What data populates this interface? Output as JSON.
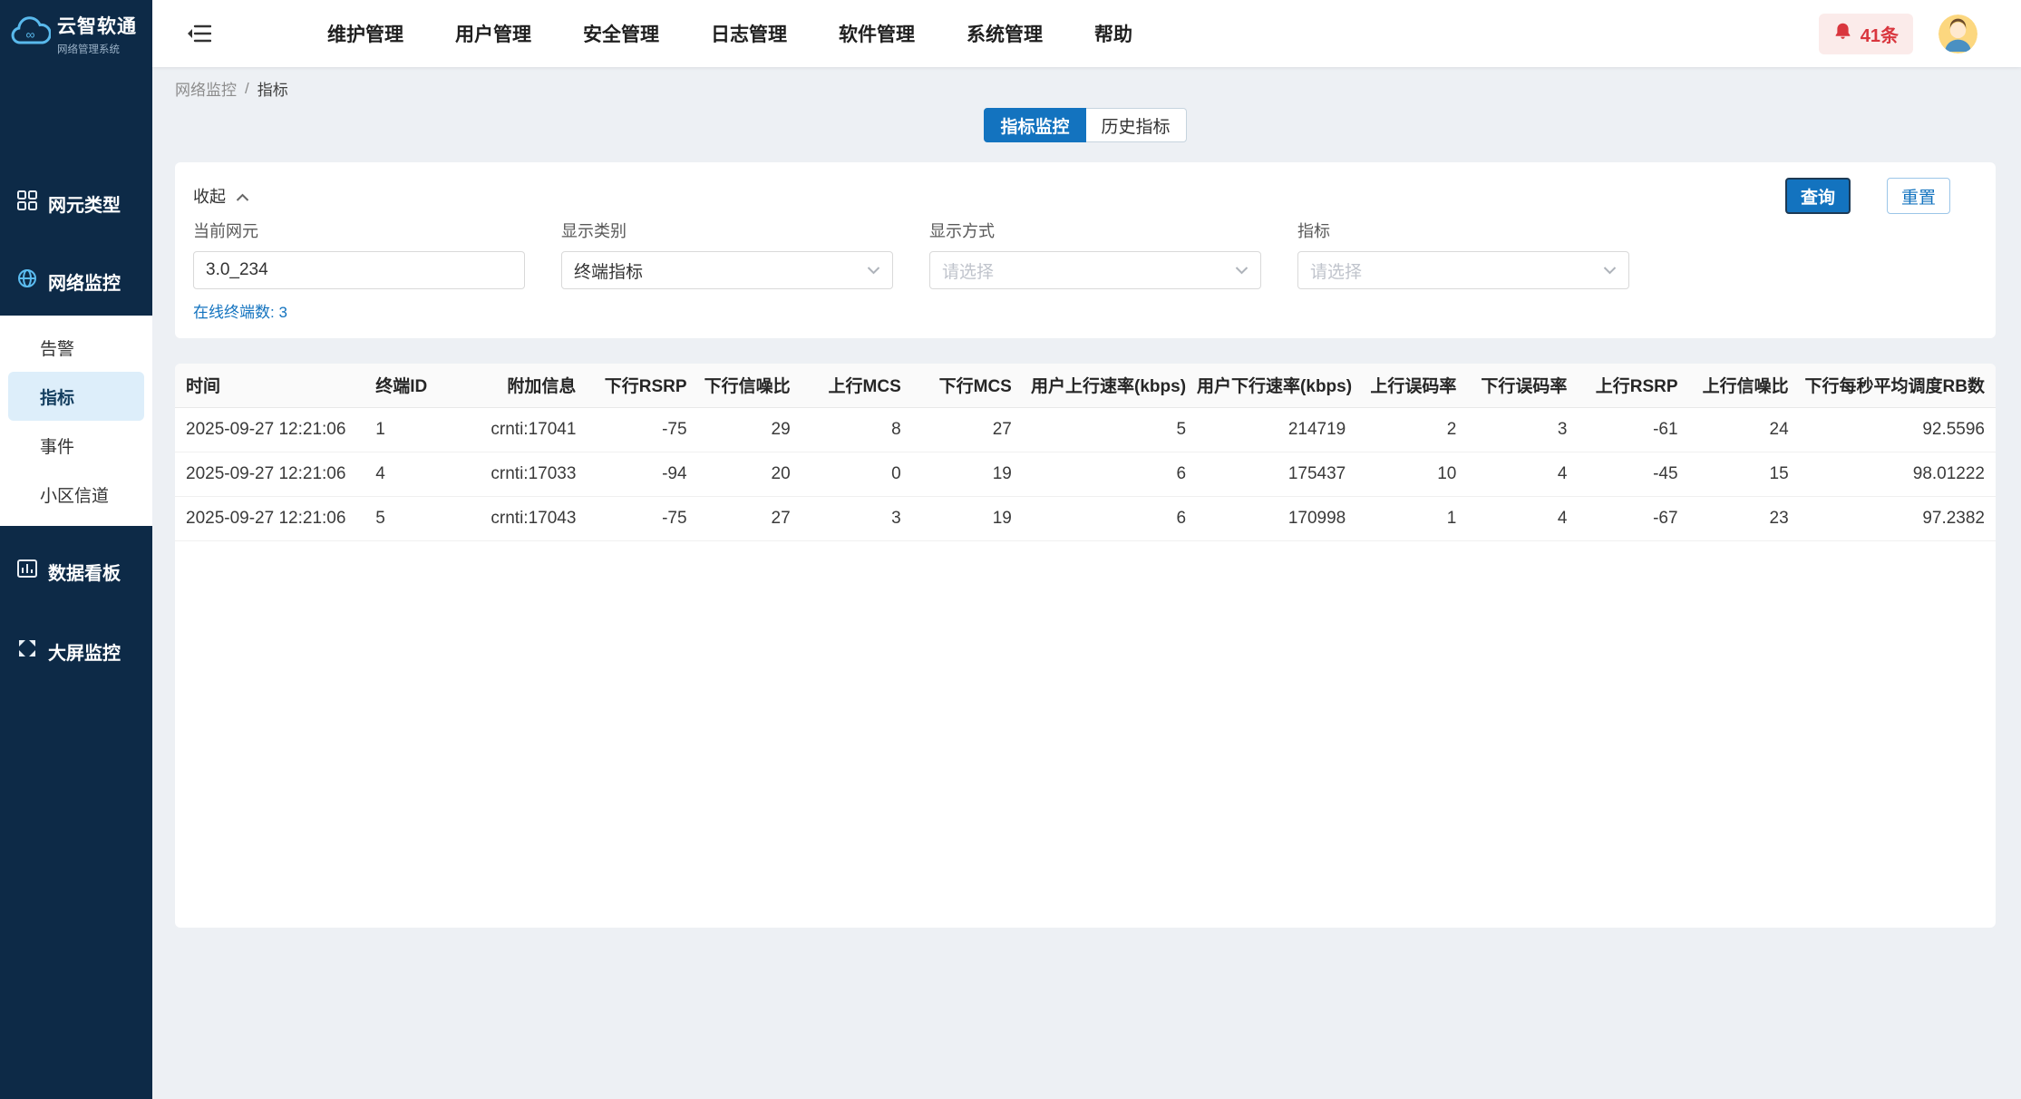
{
  "brand": {
    "name": "云智软通",
    "subtitle": "网络管理系统"
  },
  "topnav": {
    "items": [
      "维护管理",
      "用户管理",
      "安全管理",
      "日志管理",
      "软件管理",
      "系统管理",
      "帮助"
    ],
    "alarm_count": "41条"
  },
  "sidebar": {
    "items": [
      {
        "label": "网元类型"
      },
      {
        "label": "网络监控"
      },
      {
        "label": "数据看板"
      },
      {
        "label": "大屏监控"
      }
    ],
    "submenu": {
      "items": [
        "告警",
        "指标",
        "事件",
        "小区信道"
      ],
      "active": "指标"
    }
  },
  "breadcrumb": {
    "parent": "网络监控",
    "separator": "/",
    "current": "指标"
  },
  "tabs": {
    "items": [
      {
        "label": "指标监控",
        "active": true
      },
      {
        "label": "历史指标",
        "active": false
      }
    ]
  },
  "filters": {
    "collapse_label": "收起",
    "online_terminals": "在线终端数: 3",
    "query_label": "查询",
    "reset_label": "重置",
    "fields": [
      {
        "label": "当前网元",
        "value": "3.0_234"
      },
      {
        "label": "显示类别",
        "value": "终端指标"
      },
      {
        "label": "显示方式",
        "placeholder": "请选择"
      },
      {
        "label": "指标",
        "placeholder": "请选择"
      }
    ]
  },
  "table": {
    "columns": [
      "时间",
      "终端ID",
      "附加信息",
      "下行RSRP",
      "下行信噪比",
      "上行MCS",
      "下行MCS",
      "用户上行速率(kbps)",
      "用户下行速率(kbps)",
      "上行误码率",
      "下行误码率",
      "上行RSRP",
      "上行信噪比",
      "下行每秒平均调度RB数"
    ],
    "rows": [
      [
        "2025-09-27 12:21:06",
        "1",
        "crnti:17041",
        "-75",
        "29",
        "8",
        "27",
        "5",
        "214719",
        "2",
        "3",
        "-61",
        "24",
        "92.5596"
      ],
      [
        "2025-09-27 12:21:06",
        "4",
        "crnti:17033",
        "-94",
        "20",
        "0",
        "19",
        "6",
        "175437",
        "10",
        "4",
        "-45",
        "15",
        "98.01222"
      ],
      [
        "2025-09-27 12:21:06",
        "5",
        "crnti:17043",
        "-75",
        "27",
        "3",
        "19",
        "6",
        "170998",
        "1",
        "4",
        "-67",
        "23",
        "97.2382"
      ]
    ]
  },
  "colors": {
    "primary": "#1373bf",
    "sidebar_bg": "#0d2a47",
    "alarm_red": "#d9363e",
    "submenu_active_bg": "#ddeefa"
  }
}
